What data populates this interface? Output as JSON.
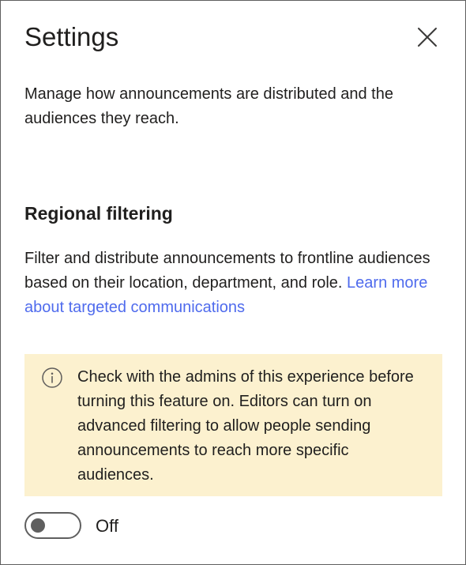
{
  "panel": {
    "title": "Settings",
    "close_icon": "close-icon",
    "description": "Manage how announcements are distributed and the audiences they reach."
  },
  "regional_filtering": {
    "heading": "Regional filtering",
    "body": "Filter and distribute announcements to frontline audiences based on their location, department, and role. ",
    "link_text": "Learn more about targeted communications"
  },
  "info_box": {
    "icon": "info-icon",
    "text": "Check with the admins of this experience before turning this feature on. Editors can turn on advanced filtering to allow people sending announcements to reach more specific audiences."
  },
  "toggle": {
    "state": "off",
    "label": "Off"
  },
  "colors": {
    "link": "#4f6bed",
    "info_background": "#fcf1cf",
    "text": "#201f1e",
    "toggle": "#5f5f5f"
  }
}
